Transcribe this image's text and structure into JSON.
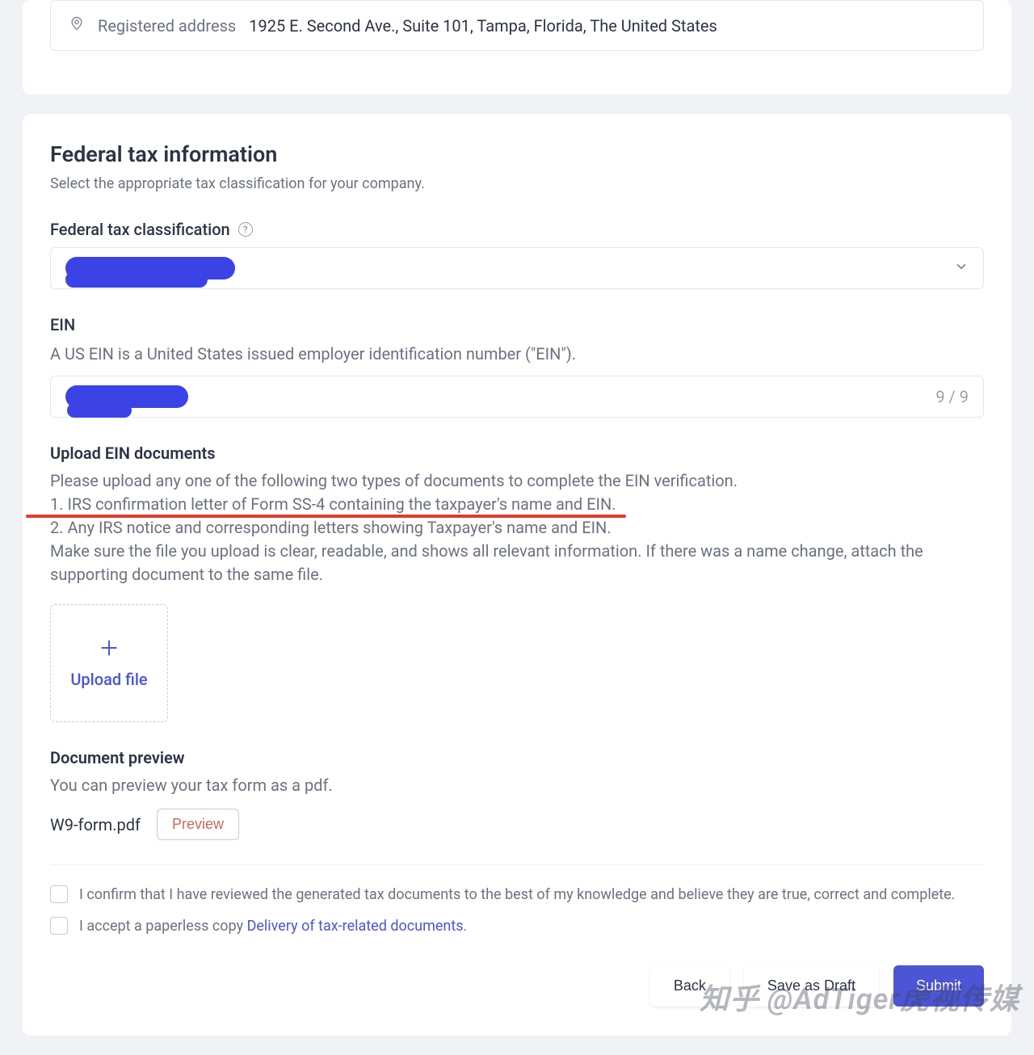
{
  "address": {
    "label": "Registered address",
    "value": "1925 E. Second Ave., Suite 101, Tampa, Florida, The United States"
  },
  "tax": {
    "title": "Federal tax information",
    "subtitle": "Select the appropriate tax classification for your company.",
    "classification_label": "Federal tax classification",
    "ein_label": "EIN",
    "ein_desc": "A US EIN is a United States issued employer identification number (\"EIN\").",
    "ein_counter": "9 / 9",
    "upload_title": "Upload EIN documents",
    "upload_p1": "Please upload any one of the following two types of documents to complete the EIN verification.",
    "upload_li1": "1. IRS confirmation letter of Form SS-4 containing the taxpayer's name and EIN.",
    "upload_li2": "2. Any IRS notice and corresponding letters showing Taxpayer's name and EIN.",
    "upload_p2": "Make sure the file you upload is clear, readable, and shows all relevant information. If there was a name change, attach the supporting document to the same file.",
    "upload_button": "Upload file",
    "preview_title": "Document preview",
    "preview_desc": "You can preview your tax form as a pdf.",
    "preview_filename": "W9-form.pdf",
    "preview_button": "Preview"
  },
  "confirm": {
    "line1": "I confirm that I have reviewed the generated tax documents to the best of my knowledge and believe they are true, correct and complete.",
    "line2_a": "I accept a paperless copy ",
    "line2_link": "Delivery of tax-related documents",
    "line2_b": "."
  },
  "actions": {
    "back": "Back",
    "save": "Save as Draft",
    "submit": "Submit"
  },
  "watermark": "知乎 @AdTiger虎视传媒"
}
